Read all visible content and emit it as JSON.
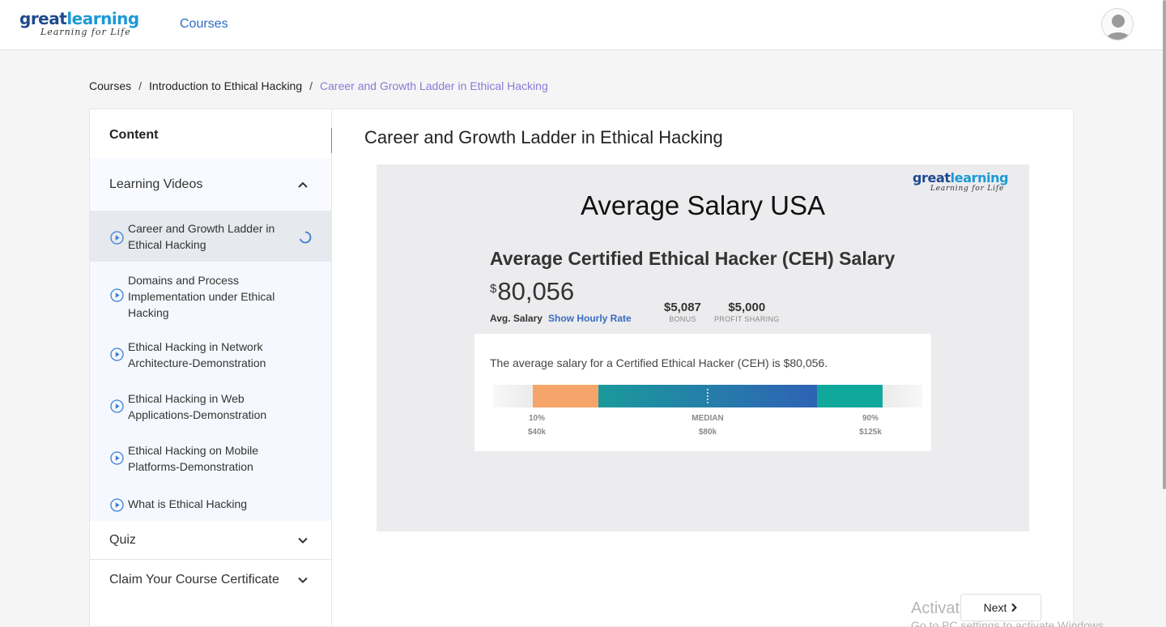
{
  "header": {
    "logo_main_1": "great",
    "logo_main_2": "learning",
    "logo_tagline": "Learning for Life",
    "nav_courses": "Courses"
  },
  "breadcrumb": {
    "items": [
      "Courses",
      "Introduction to Ethical Hacking"
    ],
    "separator": "/",
    "current": "Career and Growth Ladder in Ethical Hacking"
  },
  "sidebar": {
    "content_title": "Content",
    "sections": [
      {
        "label": "Learning Videos",
        "expanded": true,
        "items": [
          {
            "label": "Career and Growth Ladder in Ethical Hacking",
            "active": true
          },
          {
            "label": "Domains and Process Implementation under Ethical Hacking"
          },
          {
            "label": "Ethical Hacking in Network Architecture-Demonstration"
          },
          {
            "label": "Ethical Hacking in Web Applications-Demonstration"
          },
          {
            "label": "Ethical Hacking on Mobile Platforms-Demonstration"
          },
          {
            "label": "What is Ethical Hacking"
          }
        ]
      },
      {
        "label": "Quiz",
        "expanded": false
      },
      {
        "label": "Claim Your Course Certificate",
        "expanded": false
      }
    ]
  },
  "main": {
    "title": "Career and Growth Ladder in Ethical Hacking",
    "slide": {
      "logo_main_1": "great",
      "logo_main_2": "learning",
      "logo_tagline": "Learning for Life",
      "title": "Average Salary USA",
      "card": {
        "heading": "Average Certified Ethical Hacker (CEH) Salary",
        "currency": "$",
        "amount": "80,056",
        "avg_label": "Avg. Salary",
        "hourly_link": "Show Hourly Rate",
        "bonus_value": "$5,087",
        "bonus_label": "BONUS",
        "profit_value": "$5,000",
        "profit_label": "PROFIT SHARING",
        "description": "The average salary for a Certified Ethical Hacker (CEH) is $80,056.",
        "range": {
          "low_pct": "10%",
          "low_val": "$40k",
          "median_label": "MEDIAN",
          "median_val": "$80k",
          "high_pct": "90%",
          "high_val": "$125k"
        }
      }
    },
    "next_label": "Next"
  },
  "watermark": {
    "line1": "Activate Windows",
    "line2": "Go to PC settings to activate Windows."
  },
  "colors": {
    "accent": "#6a7ff0",
    "link": "#2a6dc4",
    "breadcrumb_current": "#8c79d8",
    "bar_low": "#f5a56a",
    "bar_mid_start": "#1a9a9c",
    "bar_mid_end": "#2f62b5",
    "bar_high": "#11a89c"
  }
}
